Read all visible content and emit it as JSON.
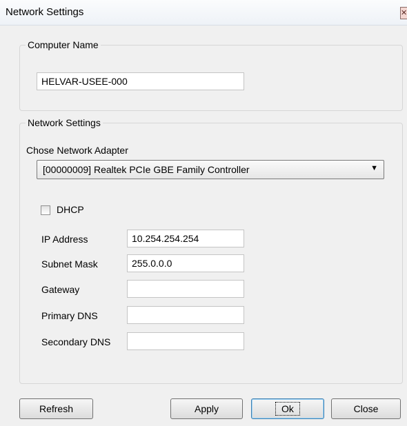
{
  "window": {
    "title": "Network Settings",
    "close_glyph": "✕"
  },
  "computer_name_group": {
    "legend": "Computer Name",
    "value": "HELVAR-USEE-000"
  },
  "network_group": {
    "legend": "Network Settings",
    "adapter_label": "Chose Network Adapter",
    "adapter_selected": "[00000009] Realtek PCIe GBE Family Controller",
    "dhcp_label": "DHCP",
    "dhcp_checked": false,
    "fields": {
      "ip_address": {
        "label": "IP Address",
        "value": "10.254.254.254"
      },
      "subnet_mask": {
        "label": "Subnet Mask",
        "value": "255.0.0.0"
      },
      "gateway": {
        "label": "Gateway",
        "value": ""
      },
      "primary_dns": {
        "label": "Primary DNS",
        "value": ""
      },
      "secondary_dns": {
        "label": "Secondary DNS",
        "value": ""
      }
    }
  },
  "buttons": {
    "refresh": "Refresh",
    "apply": "Apply",
    "ok": "Ok",
    "close": "Close"
  }
}
